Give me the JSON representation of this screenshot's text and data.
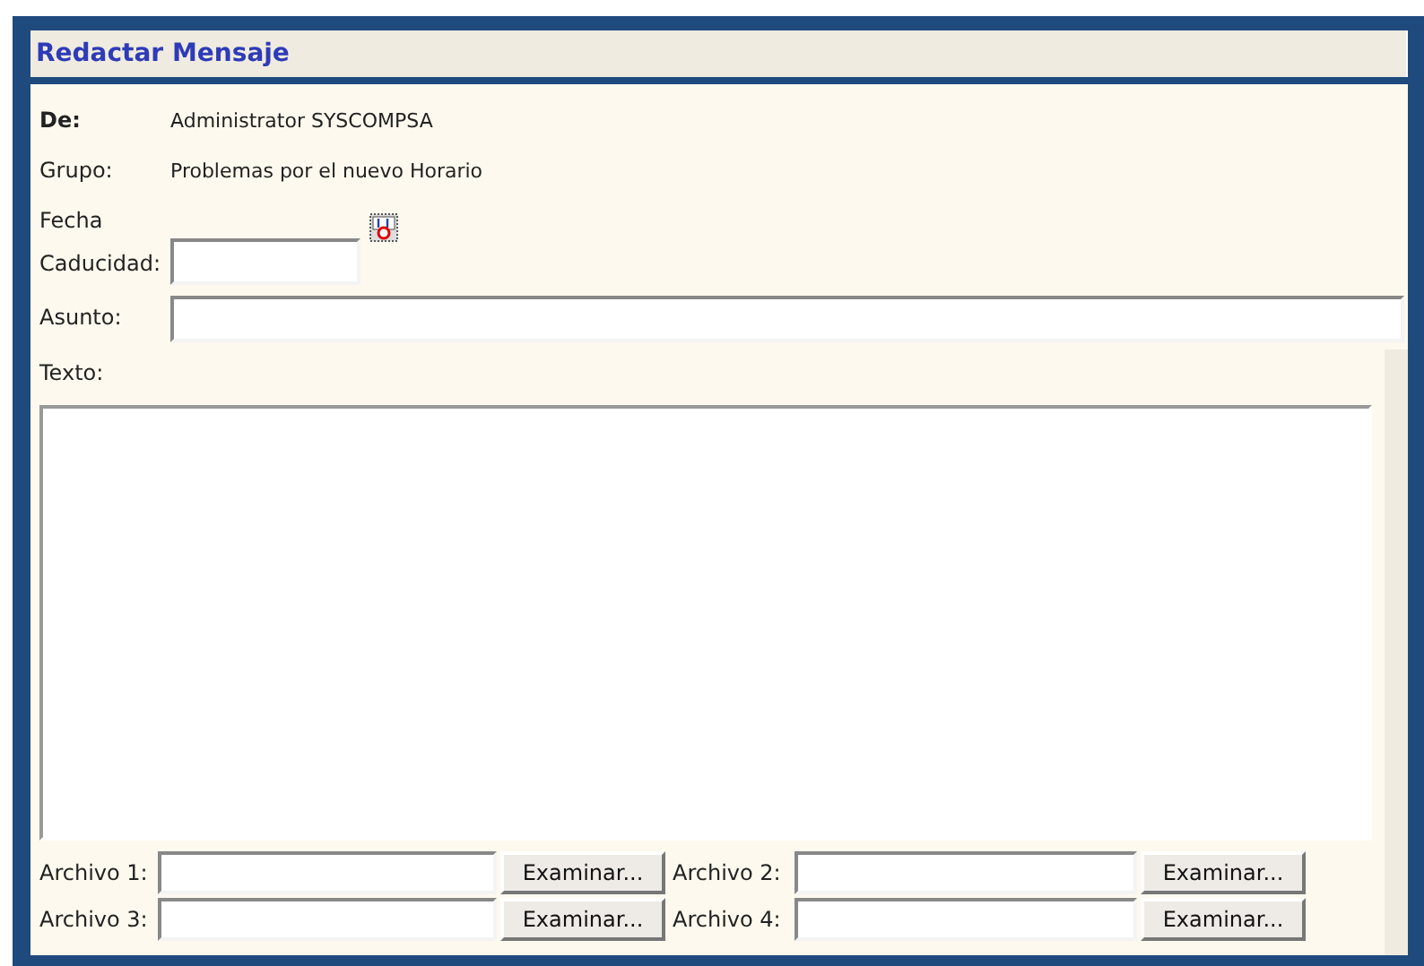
{
  "title": "Redactar Mensaje",
  "from": {
    "label": "De:",
    "value": "Administrator SYSCOMPSA"
  },
  "group": {
    "label": "Grupo:",
    "value": "Problemas por el nuevo Horario"
  },
  "expiry": {
    "label_lines": [
      "Fecha",
      "Caducidad:"
    ]
  },
  "subject": {
    "label": "Asunto:"
  },
  "body": {
    "label": "Texto:"
  },
  "attachments": [
    {
      "label": "Archivo 1:",
      "button": "Examinar..."
    },
    {
      "label": "Archivo 2:",
      "button": "Examinar..."
    },
    {
      "label": "Archivo 3:",
      "button": "Examinar..."
    },
    {
      "label": "Archivo 4:",
      "button": "Examinar..."
    }
  ]
}
